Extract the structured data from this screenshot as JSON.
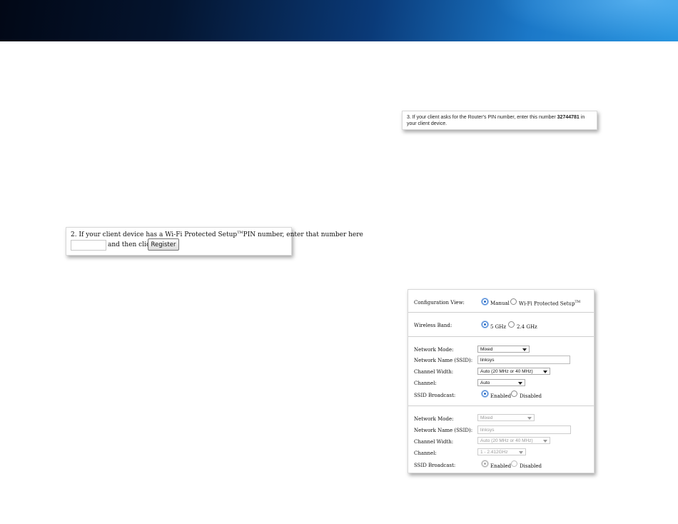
{
  "banner": {
    "colors": {
      "dark": "#020816",
      "mid": "#0a3a78",
      "light": "#2a96e0"
    }
  },
  "screenshot_wps_pin": {
    "instruction_prefix": "2. If your client device has a Wi-Fi Protected Setup",
    "tm": "TM",
    "instruction_suffix": "PIN number, enter that number here",
    "pin_value": "",
    "then_click": "and then click",
    "register_label": "Register"
  },
  "screenshot_router_pin": {
    "prefix": "3. If your client asks for the Router's PIN number, enter this number ",
    "pin": "32744781",
    "suffix": " in your client device."
  },
  "screenshot_wireless": {
    "config_view": {
      "label": "Configuration View:",
      "options": [
        {
          "label": "Manual",
          "selected": true
        },
        {
          "label": "Wi-Fi Protected Setup",
          "tm": "TM",
          "selected": false
        }
      ]
    },
    "wireless_band": {
      "label": "Wireless Band:",
      "options": [
        {
          "label": "5 GHz",
          "selected": true
        },
        {
          "label": "2.4 GHz",
          "selected": false
        }
      ]
    },
    "band_5": {
      "network_mode_label": "Network Mode:",
      "network_mode_value": "Mixed",
      "ssid_label": "Network Name (SSID):",
      "ssid_value": "linksys",
      "channel_width_label": "Channel Width:",
      "channel_width_value": "Auto (20 MHz or 40 MHz)",
      "channel_label": "Channel:",
      "channel_value": "Auto",
      "ssid_broadcast_label": "SSID Broadcast:",
      "broadcast_enabled": "Enabled",
      "broadcast_disabled": "Disabled"
    },
    "band_24": {
      "network_mode_label": "Network Mode:",
      "network_mode_value": "Mixed",
      "ssid_label": "Network Name (SSID):",
      "ssid_value": "linksys",
      "channel_width_label": "Channel Width:",
      "channel_width_value": "Auto (20 MHz or 40 MHz)",
      "channel_label": "Channel:",
      "channel_value": "1 - 2.412GHz",
      "ssid_broadcast_label": "SSID Broadcast:",
      "broadcast_enabled": "Enabled",
      "broadcast_disabled": "Disabled"
    }
  }
}
